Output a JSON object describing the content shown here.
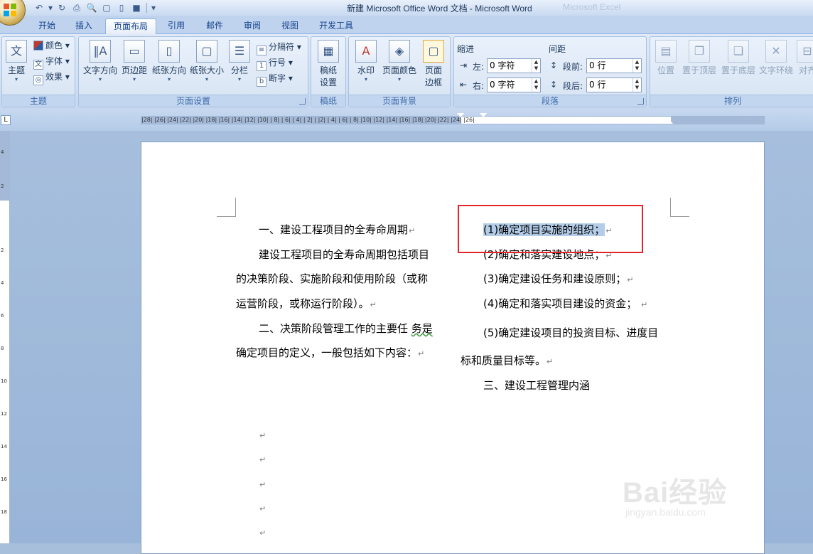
{
  "window": {
    "title": "新建 Microsoft Office Word 文档 - Microsoft Word",
    "ghost_title": "Microsoft Excel"
  },
  "qat": {
    "undo": "↶",
    "redo": "↻",
    "print": "⎙",
    "preview": "🔍",
    "new": "▢",
    "open": "▯",
    "save_icon": "■",
    "more": "▾"
  },
  "tabs": [
    "开始",
    "插入",
    "页面布局",
    "引用",
    "邮件",
    "审阅",
    "视图",
    "开发工具"
  ],
  "active_tab": "页面布局",
  "ribbon": {
    "theme": {
      "label": "主题",
      "big_button": "主题",
      "colors": "颜色",
      "fonts": "字体",
      "effects": "效果"
    },
    "page_setup": {
      "label": "页面设置",
      "text_direction": "文字方向",
      "margins": "页边距",
      "orientation": "纸张方向",
      "size": "纸张大小",
      "columns": "分栏",
      "breaks": "分隔符",
      "line_numbers": "行号",
      "hyphenation": "断字"
    },
    "draft": {
      "label": "稿纸",
      "button_line1": "稿纸",
      "button_line2": "设置"
    },
    "page_background": {
      "label": "页面背景",
      "watermark": "水印",
      "page_color": "页面颜色",
      "page_borders_line1": "页面",
      "page_borders_line2": "边框"
    },
    "paragraph": {
      "label": "段落",
      "indent_title": "缩进",
      "spacing_title": "间距",
      "left_label": "左:",
      "left_value": "0 字符",
      "right_label": "右:",
      "right_value": "0 字符",
      "before_label": "段前:",
      "before_value": "0 行",
      "after_label": "段后:",
      "after_value": "0 行"
    },
    "arrange": {
      "label": "排列",
      "position": "位置",
      "bring_front": "置于顶层",
      "send_back": "置于底层",
      "text_wrap": "文字环绕",
      "align": "对齐"
    }
  },
  "ruler": {
    "numbers": "|28|  |26|  |24|  |22|  |20|  |18|  |16|  |14|  |12|  |10|  | 8|  | 6|  | 4|  | 2|  |    |2|  | 4|  | 6|  | 8|  |10|  |12|  |14|  |16|  |18|  |20|  |22|  |24|  |26|",
    "corner": "L",
    "vertical_ticks": [
      "4",
      "2",
      "2",
      "4",
      "6",
      "8",
      "10",
      "12",
      "14",
      "16",
      "18"
    ]
  },
  "document": {
    "left_column": [
      "一、建设工程项目的全寿命周期",
      "建设工程项目的全寿命周期包括项目",
      "的决策阶段、实施阶段和使用阶段（或称",
      "运营阶段，或称运行阶段）。",
      "二、决策阶段管理工作的主要任",
      "务是",
      "确定项目的定义，一般包括如下内容："
    ],
    "right_column": [
      "(1)确定项目实施的组织；",
      "(2)确定和落实建设地点；",
      "(3)确定建设任务和建设原则；",
      "(4)确定和落实项目建设的资金；",
      "(5)确定建设项目的",
      "投资目标、进度目",
      "标和质量目标等。",
      "三、建设工程管理内涵"
    ],
    "para_mark": "↵",
    "empty_mark": "↵"
  },
  "watermark": {
    "brand": "Bai经验",
    "url": "jingyan.baidu.com"
  },
  "colors": {
    "annotation_box": "#e0262a",
    "selection": "#b3cde9"
  }
}
